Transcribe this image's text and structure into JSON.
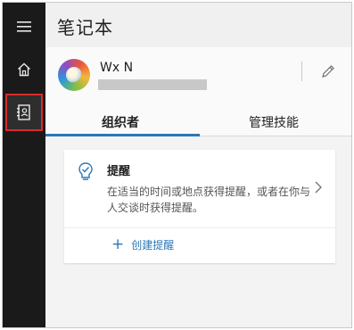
{
  "app": {
    "title": "笔记本"
  },
  "rail": {
    "items": [
      {
        "icon": "hamburger-menu-icon"
      },
      {
        "icon": "home-icon"
      },
      {
        "icon": "notebook-icon",
        "selected": true
      }
    ]
  },
  "profile": {
    "name": "Wx N",
    "email_redacted": true,
    "edit_icon": "pencil-icon"
  },
  "tabs": [
    {
      "label": "组织者",
      "active": true
    },
    {
      "label": "管理技能",
      "active": false
    }
  ],
  "card": {
    "icon": "lightbulb-check-icon",
    "title": "提醒",
    "description": "在适当的时间或地点获得提醒，或者在你与人交谈时获得提醒。",
    "chevron_icon": "chevron-right-icon",
    "action": {
      "icon": "plus-icon",
      "label": "创建提醒"
    }
  },
  "colors": {
    "rail_bg": "#1a1a1a",
    "accent": "#2b78b8",
    "selection_outline": "#d92b2b",
    "pane_bg": "#f3f3f3"
  }
}
